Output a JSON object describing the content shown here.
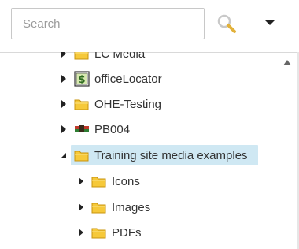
{
  "search": {
    "placeholder": "Search",
    "value": ""
  },
  "icons": {
    "search": "magnifier-icon",
    "menu": "caret-down-icon",
    "folder": "folder-icon",
    "scroll_up": "triangle-up-icon"
  },
  "colors": {
    "selected_bg": "#cfe8f3",
    "folder_fill": "#f6c93a",
    "folder_stroke": "#c8940d"
  },
  "tree": {
    "items": [
      {
        "label": "LC Media",
        "icon": "folder-icon",
        "expanded": false,
        "level": 0,
        "selected": false
      },
      {
        "label": "officeLocator",
        "icon": "dollar-app-icon",
        "expanded": false,
        "level": 0,
        "selected": false
      },
      {
        "label": "OHE-Testing",
        "icon": "folder-icon",
        "expanded": false,
        "level": 0,
        "selected": false
      },
      {
        "label": "PB004",
        "icon": "image-thumbnail-icon",
        "expanded": false,
        "level": 0,
        "selected": false
      },
      {
        "label": "Training site media examples",
        "icon": "folder-icon",
        "expanded": true,
        "level": 0,
        "selected": true
      },
      {
        "label": "Icons",
        "icon": "folder-icon",
        "expanded": false,
        "level": 1,
        "selected": false
      },
      {
        "label": "Images",
        "icon": "folder-icon",
        "expanded": false,
        "level": 1,
        "selected": false
      },
      {
        "label": "PDFs",
        "icon": "folder-icon",
        "expanded": false,
        "level": 1,
        "selected": false
      }
    ]
  }
}
